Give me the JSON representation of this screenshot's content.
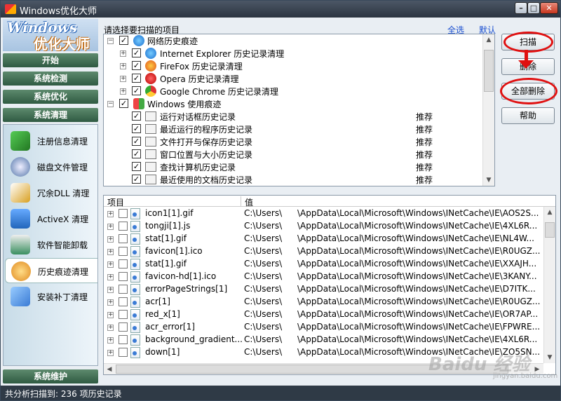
{
  "window": {
    "title": "Windows优化大师"
  },
  "logo": {
    "line1": "Windows",
    "line2": "优化大师"
  },
  "nav": {
    "start": "开始",
    "check": "系统检测",
    "optimize": "系统优化",
    "clean": "系统清理",
    "maintain": "系统维护",
    "items": [
      {
        "label": "注册信息清理",
        "icon": "registry-icon",
        "color": "#3a9a3a"
      },
      {
        "label": "磁盘文件管理",
        "icon": "disk-icon",
        "color": "#5577aa"
      },
      {
        "label": "冗余DLL 清理",
        "icon": "dll-icon",
        "color": "#d9a020"
      },
      {
        "label": "ActiveX 清理",
        "icon": "activex-icon",
        "color": "#2a6fb8"
      },
      {
        "label": "软件智能卸载",
        "icon": "uninstall-icon",
        "color": "#3a8f60"
      },
      {
        "label": "历史痕迹清理",
        "icon": "history-icon",
        "color": "#e08a20"
      },
      {
        "label": "安装补丁清理",
        "icon": "patch-icon",
        "color": "#3a7bd5"
      }
    ]
  },
  "options": {
    "label": "请选择要扫描的项目",
    "select_all": "全选",
    "default": "默认"
  },
  "tree": [
    {
      "label": "网络历史痕迹",
      "rec": "",
      "icon": "ie-icon",
      "level": 0
    },
    {
      "label": "Internet Explorer 历史记录清理",
      "rec": "",
      "icon": "ie-icon",
      "level": 1
    },
    {
      "label": "FireFox 历史记录清理",
      "rec": "",
      "icon": "firefox-icon",
      "level": 1
    },
    {
      "label": "Opera 历史记录清理",
      "rec": "",
      "icon": "opera-icon",
      "level": 1
    },
    {
      "label": "Google Chrome 历史记录清理",
      "rec": "",
      "icon": "chrome-icon",
      "level": 1
    },
    {
      "label": "Windows 使用痕迹",
      "rec": "",
      "icon": "windows-icon",
      "level": 0
    },
    {
      "label": "运行对话框历史记录",
      "rec": "推荐",
      "icon": "run-icon",
      "level": 2
    },
    {
      "label": "最近运行的程序历史记录",
      "rec": "推荐",
      "icon": "program-icon",
      "level": 2
    },
    {
      "label": "文件打开与保存历史记录",
      "rec": "推荐",
      "icon": "folder-icon",
      "level": 2
    },
    {
      "label": "窗口位置与大小历史记录",
      "rec": "推荐",
      "icon": "window-icon",
      "level": 2
    },
    {
      "label": "查找计算机历史记录",
      "rec": "推荐",
      "icon": "search-icon",
      "level": 2
    },
    {
      "label": "最近使用的文档历史记录",
      "rec": "推荐",
      "icon": "document-icon",
      "level": 2
    }
  ],
  "buttons": {
    "scan": "扫描",
    "delete": "删除",
    "delete_all": "全部删除",
    "help": "帮助"
  },
  "results": {
    "col_item": "项目",
    "col_value": "值",
    "rows": [
      {
        "name": "icon1[1].gif",
        "user": "C:\\Users\\",
        "path": "\\AppData\\Local\\Microsoft\\Windows\\INetCache\\IE\\AOS2S..."
      },
      {
        "name": "tongji[1].js",
        "user": "C:\\Users\\",
        "path": "\\AppData\\Local\\Microsoft\\Windows\\INetCache\\IE\\4XL6R..."
      },
      {
        "name": "stat[1].gif",
        "user": "C:\\Users\\",
        "path": "\\AppData\\Local\\Microsoft\\Windows\\INetCache\\IE\\NL4W..."
      },
      {
        "name": "favicon[1].ico",
        "user": "C:\\Users\\",
        "path": "\\AppData\\Local\\Microsoft\\Windows\\INetCache\\IE\\R0UGZ..."
      },
      {
        "name": "stat[1].gif",
        "user": "C:\\Users\\",
        "path": "\\AppData\\Local\\Microsoft\\Windows\\INetCache\\IE\\XXAJH..."
      },
      {
        "name": "favicon-hd[1].ico",
        "user": "C:\\Users\\",
        "path": "\\AppData\\Local\\Microsoft\\Windows\\INetCache\\IE\\3KANY..."
      },
      {
        "name": "errorPageStrings[1]",
        "user": "C:\\Users\\",
        "path": "\\AppData\\Local\\Microsoft\\Windows\\INetCache\\IE\\D7ITK..."
      },
      {
        "name": "acr[1]",
        "user": "C:\\Users\\",
        "path": "\\AppData\\Local\\Microsoft\\Windows\\INetCache\\IE\\R0UGZ..."
      },
      {
        "name": "red_x[1]",
        "user": "C:\\Users\\",
        "path": "\\AppData\\Local\\Microsoft\\Windows\\INetCache\\IE\\OR7AP..."
      },
      {
        "name": "acr_error[1]",
        "user": "C:\\Users\\",
        "path": "\\AppData\\Local\\Microsoft\\Windows\\INetCache\\IE\\FPWRE..."
      },
      {
        "name": "background_gradient...",
        "user": "C:\\Users\\",
        "path": "\\AppData\\Local\\Microsoft\\Windows\\INetCache\\IE\\4XL6R..."
      },
      {
        "name": "down[1]",
        "user": "C:\\Users\\",
        "path": "\\AppData\\Local\\Microsoft\\Windows\\INetCache\\IE\\ZO5SN..."
      }
    ]
  },
  "status": {
    "text": "共分析扫描到: 236 项历史记录"
  },
  "watermark": {
    "main": "Baidu 经验",
    "sub": "jingyan.baidu.com"
  },
  "annotation": {
    "color": "#e01010"
  }
}
